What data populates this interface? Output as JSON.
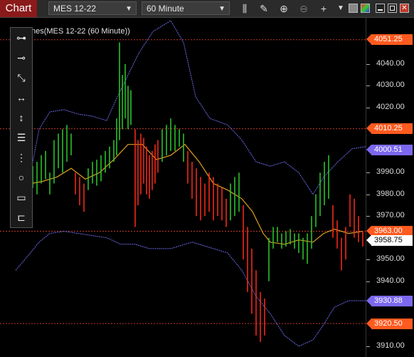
{
  "toolbar": {
    "chart_tab": "Chart",
    "instrument": "MES 12-22",
    "interval": "60 Minute",
    "icons": [
      "bar-type-icon",
      "draw-pencil-icon",
      "zoom-in-icon",
      "zoom-out-icon",
      "crosshair-icon",
      "dropdown-arrow-icon",
      "color-palette-icon",
      "minimize-icon",
      "maximize-icon",
      "close-icon"
    ]
  },
  "chart_title": "nes(MES 12-22 (60 Minute))",
  "drawing_tools": [
    "line-tool",
    "ray-tool",
    "extended-line-tool",
    "horizontal-line-tool",
    "vertical-line-tool",
    "fibonacci-tool",
    "andrews-pitchfork-tool",
    "ellipse-tool",
    "rectangle-tool",
    "ruler-tool"
  ],
  "price_labels": [
    {
      "text": "4051.25",
      "value": 4051.25,
      "color": "#ff5a1f"
    },
    {
      "text": "4010.25",
      "value": 4010.25,
      "color": "#ff5a1f"
    },
    {
      "text": "4000.51",
      "value": 4000.51,
      "color": "#7b68ee"
    },
    {
      "text": "3963.00",
      "value": 3963.0,
      "color": "#ff5a1f"
    },
    {
      "text": "3958.75",
      "value": 3958.75,
      "color": "#ffffff"
    },
    {
      "text": "3930.88",
      "value": 3930.88,
      "color": "#7b68ee"
    },
    {
      "text": "3920.50",
      "value": 3920.5,
      "color": "#ff5a1f"
    }
  ],
  "axis_ticks": [
    "4040.00",
    "4030.00",
    "4020.00",
    "3990.00",
    "3980.00",
    "3970.00",
    "3950.00",
    "3940.00",
    "3910.00"
  ],
  "horizontal_lines": [
    4051.25,
    4010.25,
    3963.0,
    3920.5
  ],
  "colors": {
    "up": "#2ecc2e",
    "down": "#ff2a1a",
    "bollinger": "#6a6ae8",
    "ma": "#e0a020",
    "hline": "#c0392b"
  }
}
